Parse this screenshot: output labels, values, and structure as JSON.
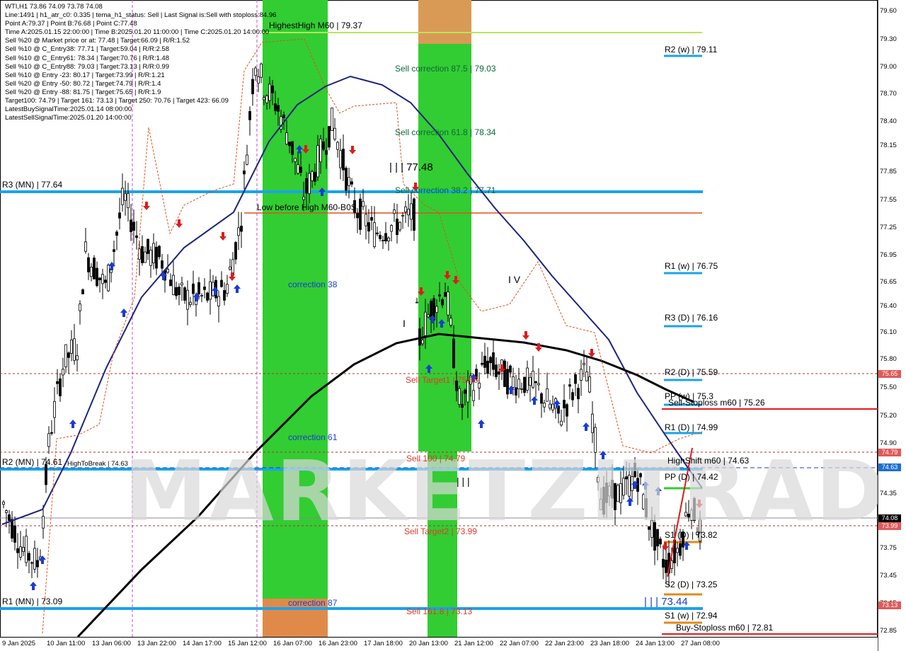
{
  "info_lines": [
    "WTI,H1  73.86 74.09 73.78 74.08",
    "Line:1491  | h1_atr_c0: 0.335  | tema_h1_status: Sell  | Last Signal is:Sell with stoploss:84.96",
    "Point A:79.37  | Point B:76.68  | Point C:77.48",
    "Time A:2025.01.15 22:00:00  | Time B:2025.01.20 11:00:00  | Time C:2025.01.20 14:00:00",
    "Sell %20 @ Market price or at: 77.48  | Target:66.09  | R/R:1.52",
    "Sell %10 @ C_Entry38: 77.71  | Target:59.04  | R/R:2.58",
    "Sell %10 @ C_Entry61: 78.34  | Target:70.76  | R/R:1.48",
    "Sell %10 @ C_Entry88: 79.03  | Target:73.13  | R/R:0.99",
    "Sell %10 @ Entry -23: 80.17  | Target:73.99  | R/R:1.21",
    "Sell %20 @ Entry -50: 80.72  | Target:74.79  | R/R:1.4",
    "Sell %20 @ Entry -88: 81.75  | Target:75.65  | R/R:1.9",
    "Target100: 74.79  | Target 161: 73.13  | Target 250: 70.76  | Target 423: 66.09",
    "LatestBuySignalTime:2025.01.14 08:00:00",
    "LatestSellSignalTime:2025.01.20 14:00:00"
  ],
  "watermark": "MARKETZITRADE",
  "price_axis": {
    "ticks": [
      "79.60",
      "79.30",
      "79.00",
      "78.70",
      "78.40",
      "78.15",
      "77.85",
      "77.55",
      "77.25",
      "76.95",
      "76.65",
      "76.40",
      "76.10",
      "75.80",
      "75.50",
      "75.20",
      "74.90",
      "74.65",
      "74.35",
      "74.05",
      "73.75",
      "73.45",
      "73.15",
      "72.85"
    ],
    "tags": [
      {
        "text": "75.65",
        "color": "#e05a5a"
      },
      {
        "text": "74.79",
        "color": "#e05a5a"
      },
      {
        "text": "74.63",
        "color": "#1f6fd1"
      },
      {
        "text": "74.08",
        "color": "#000000"
      },
      {
        "text": "73.99",
        "color": "#e05a5a"
      },
      {
        "text": "73.13",
        "color": "#e05a5a"
      }
    ]
  },
  "time_axis": [
    "9 Jan 2025",
    "10 Jan 11:00",
    "13 Jan 06:00",
    "13 Jan 22:00",
    "14 Jan 17:00",
    "15 Jan 12:00",
    "16 Jan 07:00",
    "16 Jan 23:00",
    "17 Jan 18:00",
    "20 Jan 13:00",
    "21 Jan 12:00",
    "22 Jan 07:00",
    "22 Jan 23:00",
    "23 Jan 18:00",
    "24 Jan 13:00",
    "27 Jan 08:00"
  ],
  "labels": {
    "highest_high": "HighestHigh   M60 | 79.37",
    "r3_mn": "R3 (MN) | 77.64",
    "r2_mn": "R2 (MN) | 74.61",
    "s1_mn": "R1 (MN) | 73.09",
    "high_to_break": "HighToBreak | 74.63",
    "low_before_high": "Low before High   M60-B0S",
    "sell_corr_875": "Sell correction 87.5 | 79.03",
    "sell_corr_618": "Sell correction 61.8 | 78.34",
    "sell_corr_382": "Sell correction 38.2 | 77.71",
    "wave_c": "| | | 77.48",
    "wave_iv": "I V",
    "wave_i": "I",
    "wave_iii": "| | |",
    "wave_iii_low": "| | | 73.44",
    "correction_38": "correction 38",
    "correction_61": "correction 61",
    "correction_87": "correction 87",
    "sell_target1": "Sell Target1 | 75.65",
    "sell_100": "Sell 100 | 74.79",
    "sell_target2": "Sell Target2 | 73.99",
    "sell_161": "Sell 161.8 | 73.13",
    "r2_w": "R2 (w) | 79.11",
    "r1_w": "R1 (w) | 76.75",
    "r3_d": "R3 (D) | 76.16",
    "r2_d": "R2 (D) | 75.59",
    "pp_w": "PP (w) | 75.3",
    "sell_stoploss": "Sell-Stoploss m60 | 75.26",
    "r1_d": "R1 (D) | 74.99",
    "high_shift": "HighShift m60 | 74.63",
    "pp_d": "PP (D) | 74.42",
    "s1_d": "S1 (D) | 73.82",
    "s2_d": "S2 (D) | 73.25",
    "s1_w": "S1 (w) | 72.94",
    "buy_stoploss": "Buy-Stoploss m60 | 72.81"
  },
  "colors": {
    "pivot_blue": "#1aa3e8",
    "sell_red": "#e03a2a",
    "zone_green": "#32cd32",
    "zone_orange": "#e08a4a",
    "ma_navy": "#1a237e",
    "ma_black": "#000000"
  }
}
